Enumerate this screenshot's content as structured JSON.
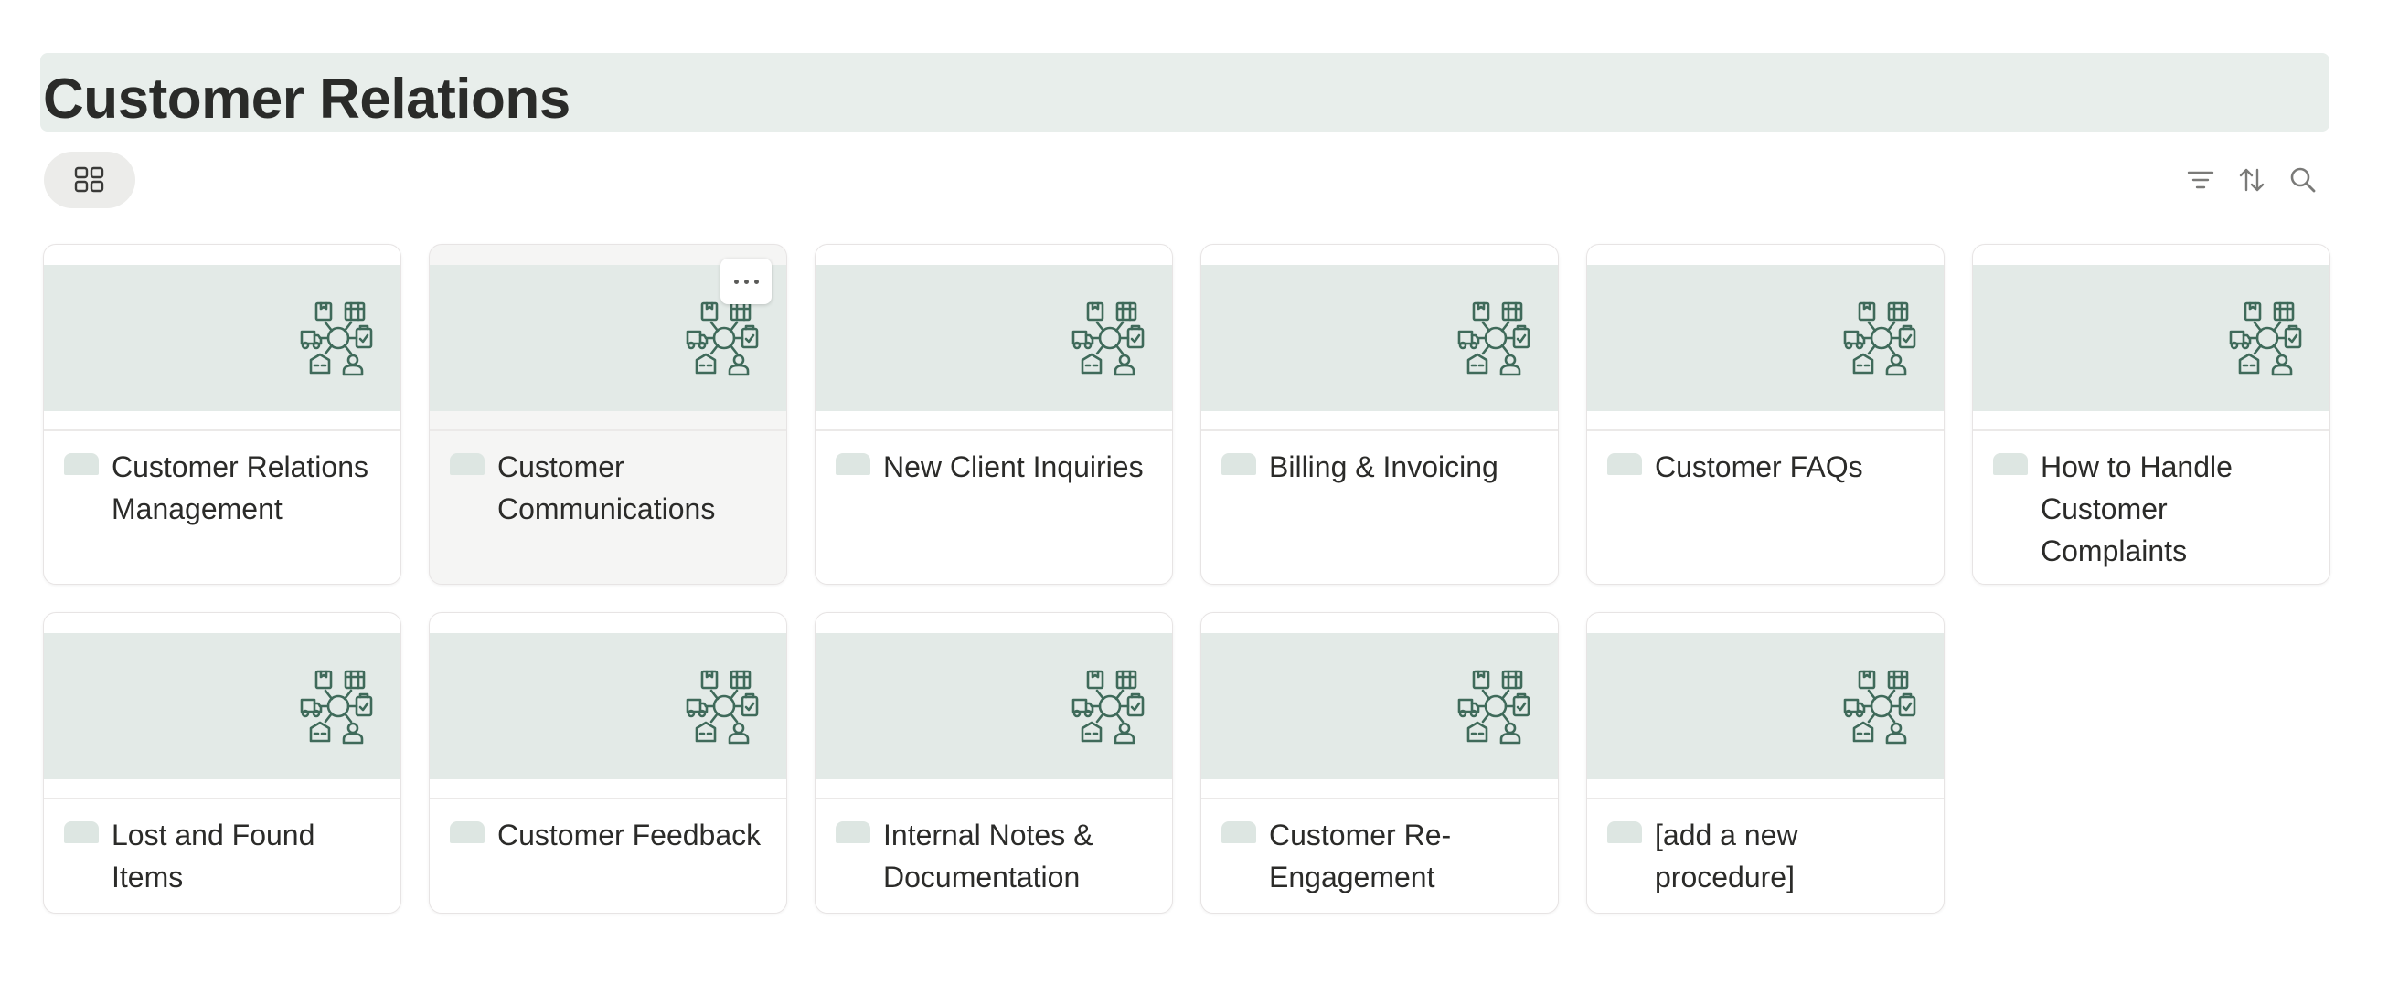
{
  "page": {
    "title": "Customer Relations"
  },
  "toolbar": {
    "view_icon": "gallery-grid-icon",
    "filter_icon": "filter-icon",
    "sort_icon": "sort-icon",
    "search_icon": "search-icon"
  },
  "cards": [
    {
      "title": "Customer Relations Management"
    },
    {
      "title": "Customer Communications"
    },
    {
      "title": "New Client Inquiries"
    },
    {
      "title": "Billing & Invoicing"
    },
    {
      "title": "Customer FAQs"
    },
    {
      "title": "How to Handle Customer Complaints"
    },
    {
      "title": "Lost and Found Items"
    },
    {
      "title": "Customer Feedback"
    },
    {
      "title": "Internal Notes & Documentation"
    },
    {
      "title": "Customer Re-Engagement"
    },
    {
      "title": "[add a new procedure]"
    }
  ],
  "cover_icon": "logistics-network-icon",
  "colors": {
    "title_bg": "#e8eeeb",
    "cover_bg": "#e3eae7",
    "icon_stroke": "#3f6a5a"
  }
}
